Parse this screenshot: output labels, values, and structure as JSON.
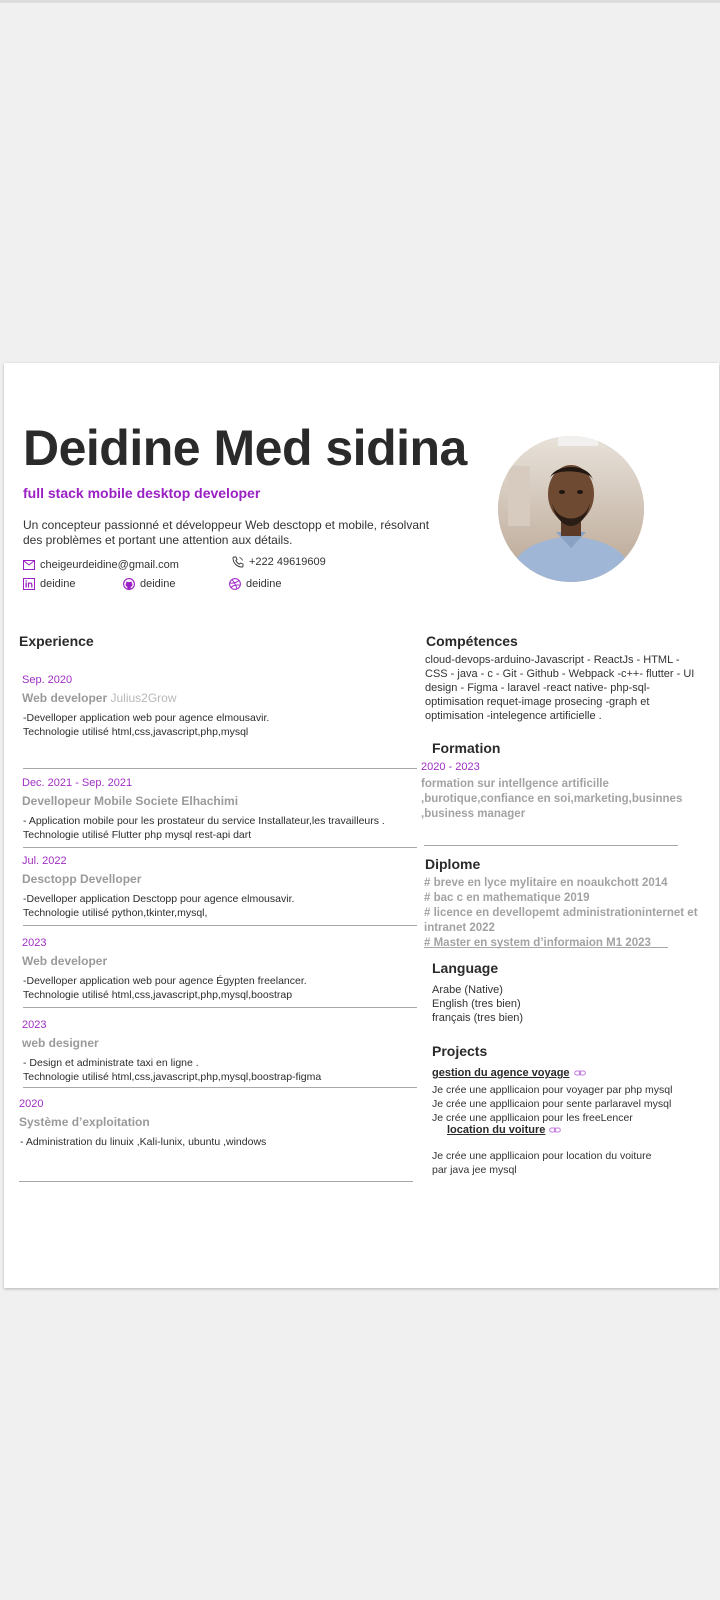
{
  "header": {
    "name": "Deidine Med sidina",
    "role": "full stack mobile desktop  developer",
    "bio": "Un concepteur passionné et développeur Web desctopp et mobile, résolvant des problèmes et portant une attention aux détails."
  },
  "contacts": {
    "email": "cheigeurdeidine@gmail.com",
    "phone": "+222 49619609",
    "linkedin": "deidine",
    "github": "deidine",
    "dribbble": "deidine"
  },
  "experience": {
    "heading": "Experience",
    "items": [
      {
        "date": "Sep. 2020",
        "title": "Web developer",
        "company": "Julius2Grow",
        "desc1": "-Develloper application web pour agence elmousavir.",
        "desc2": "Technologie utilisé  html,css,javascript,php,mysql"
      },
      {
        "date": "Dec. 2021 - Sep. 2021",
        "title": "Devellopeur  Mobile Societe Elhachimi",
        "company": "",
        "desc1": "- Application mobile pour les prostateur du service Installateur,les travailleurs .",
        "desc2": "Technologie utilisé  Flutter php mysql rest-api dart"
      },
      {
        "date": "Jul. 2022",
        "title": "Desctopp Develloper",
        "company": "",
        "desc1": "-Develloper application Desctopp pour agence elmousavir.",
        "desc2": "Technologie utilisé  python,tkinter,mysql,"
      },
      {
        "date": "2023",
        "title": "Web developer",
        "company": "",
        "desc1": "-Develloper application web pour agence Égypten freelancer.",
        "desc2": "Technologie utilisé  html,css,javascript,php,mysql,boostrap"
      },
      {
        "date": "2023",
        "title": "web designer",
        "company": "",
        "desc1": "- Design et administrate taxi en ligne .",
        "desc2": "Technologie utilisé  html,css,javascript,php,mysql,boostrap-figma"
      },
      {
        "date": "2020",
        "title": "Système d’exploitation",
        "company": "",
        "desc1": "- Administration du linuix ,Kali-lunix, ubuntu ,windows",
        "desc2": ""
      }
    ]
  },
  "competences": {
    "heading": "Compétences",
    "lines": [
      "cloud-devops-arduino-Javascript - ReactJs - HTML -",
      "CSS - java - c - Git - Github - Webpack -c++- flutter - UI",
      "design - Figma - laravel -react native- php-sql-",
      "optimisation requet-image prosecing -graph et",
      "optimisation -intelegence artificielle ."
    ]
  },
  "formation": {
    "heading": "Formation",
    "date": "2020 - 2023",
    "lines": [
      "formation sur intellgence artificille",
      ",burotique,confiance en soi,marketing,businnes",
      ",business manager"
    ]
  },
  "diplome": {
    "heading": "Diplome",
    "lines": [
      "# breve en lyce mylitaire en noaukchott 2014",
      "# bac c en mathematique  2019",
      "# licence en devellopemt administrationinternet et",
      "intranet 2022",
      "# Master en system d’informaion M1 2023"
    ]
  },
  "language": {
    "heading": "Language",
    "items": [
      "Arabe (Native)",
      "English (tres bien)",
      "français (tres bien)"
    ]
  },
  "projects": {
    "heading": "Projects",
    "p1_title": "gestion du agence  voyage",
    "p1_lines": [
      "Je crée une appllicaion pour voyager par php mysql",
      "Je crée une appllicaion pour sente parlaravel mysql",
      "Je crée une appllicaion pour les freeLencer"
    ],
    "p2_title": "location du voiture",
    "p2_lines": [
      "Je crée une appllicaion pour location du voiture",
      "par java jee mysql"
    ]
  },
  "colors": {
    "accent": "#9a1fc4",
    "date": "#a02ec4",
    "muted": "#a3a3a3"
  }
}
